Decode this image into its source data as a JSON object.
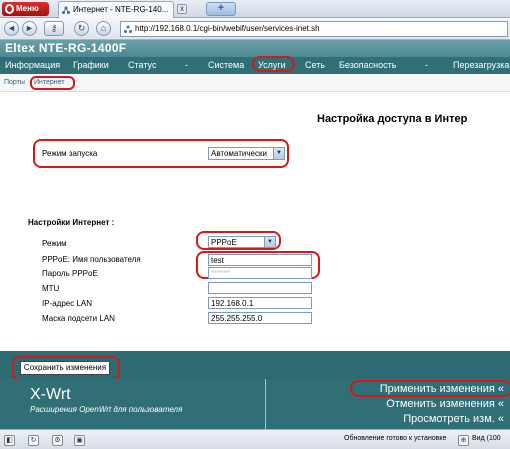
{
  "browser": {
    "menu_label": "Меню",
    "tab_title": "Интернет - NTE-RG-140...",
    "tab_close": "x",
    "new_tab": "+",
    "address": "http://192.168.0.1/cgi-bin/webif/user/services-inet.sh",
    "buttons": {
      "back": "◄",
      "forward": "►",
      "key": "⚷",
      "reload": "↻",
      "home": "⌂"
    }
  },
  "page": {
    "device_title": "Eltex NTE-RG-1400F",
    "main_nav": [
      "Информация",
      "Графики",
      "Статус",
      "-",
      "Система",
      "Услуги",
      "Сеть",
      "Безопасность",
      "-",
      "Перезагрузка"
    ],
    "sub_nav": [
      "Порты",
      "Интернет"
    ],
    "heading": "Настройка доступа в Интер",
    "launch_mode": {
      "label": "Режим запуска",
      "value": "Автоматически"
    },
    "section_title": "Настройки Интернет :",
    "fields": {
      "mode": {
        "label": "Режим",
        "value": "PPPoE"
      },
      "user": {
        "label": "PPPoE: Имя пользователя",
        "value": "test"
      },
      "pass": {
        "label": "Пароль PPPoE",
        "value": "******"
      },
      "mtu": {
        "label": "MTU",
        "value": ""
      },
      "ip": {
        "label": "IP-адрес LAN",
        "value": "192.168.0.1"
      },
      "mask": {
        "label": "Маска подсети LAN",
        "value": "255.255.255.0"
      }
    },
    "save_label": "Сохранить изменения",
    "footer": {
      "brand": "X-Wrt",
      "tagline": "Расширения OpenWrt для пользователя",
      "apply": "Применить изменения «",
      "cancel": "Отменить изменения «",
      "review": "Просмотреть изм. «"
    }
  },
  "status": {
    "text": "Обновление готово к установке",
    "view": "Вид (100"
  },
  "colors": {
    "highlight": "#d21a1a",
    "teal": "#2f6f75"
  }
}
